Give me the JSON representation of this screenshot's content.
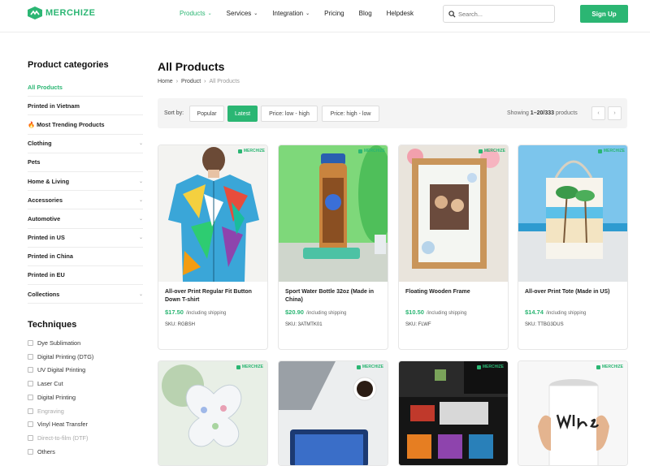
{
  "header": {
    "logo_text": "MERCHIZE",
    "nav": [
      {
        "label": "Products",
        "dropdown": true,
        "active": true
      },
      {
        "label": "Services",
        "dropdown": true,
        "active": false
      },
      {
        "label": "Integration",
        "dropdown": true,
        "active": false
      },
      {
        "label": "Pricing",
        "dropdown": false,
        "active": false
      },
      {
        "label": "Blog",
        "dropdown": false,
        "active": false
      },
      {
        "label": "Helpdesk",
        "dropdown": false,
        "active": false
      }
    ],
    "search_placeholder": "Search...",
    "signup_label": "Sign Up"
  },
  "sidebar": {
    "categories_title": "Product categories",
    "categories": [
      {
        "label": "All Products",
        "expandable": false
      },
      {
        "label": "Printed in Vietnam",
        "expandable": false
      },
      {
        "label": "Most Trending Products",
        "expandable": false,
        "icon": "fire-icon"
      },
      {
        "label": "Clothing",
        "expandable": true
      },
      {
        "label": "Pets",
        "expandable": false
      },
      {
        "label": "Home & Living",
        "expandable": true
      },
      {
        "label": "Accessories",
        "expandable": true
      },
      {
        "label": "Automotive",
        "expandable": true
      },
      {
        "label": "Printed in US",
        "expandable": true
      },
      {
        "label": "Printed in China",
        "expandable": false
      },
      {
        "label": "Printed in EU",
        "expandable": false
      },
      {
        "label": "Collections",
        "expandable": true
      }
    ],
    "techniques_title": "Techniques",
    "techniques": [
      {
        "label": "Dye Sublimation",
        "enabled": true
      },
      {
        "label": "Digital Printing (DTG)",
        "enabled": true
      },
      {
        "label": "UV Digital Printing",
        "enabled": true
      },
      {
        "label": "Laser Cut",
        "enabled": true
      },
      {
        "label": "Digital Printing",
        "enabled": true
      },
      {
        "label": "Engraving",
        "enabled": false
      },
      {
        "label": "Vinyl Heat Transfer",
        "enabled": true
      },
      {
        "label": "Direct-to-film (DTF)",
        "enabled": false
      },
      {
        "label": "Others",
        "enabled": true
      }
    ]
  },
  "main": {
    "title": "All Products",
    "breadcrumb": [
      "Home",
      "Product",
      "All Products"
    ],
    "sort_label": "Sort by:",
    "sort_options": [
      {
        "label": "Popular",
        "active": false
      },
      {
        "label": "Latest",
        "active": true
      },
      {
        "label": "Price: low - high",
        "active": false
      },
      {
        "label": "Price: high - low",
        "active": false
      }
    ],
    "showing_prefix": "Showing ",
    "showing_range": "1–20/333",
    "showing_suffix": " products",
    "prev_label": "‹",
    "next_label": "›"
  },
  "brand_mark": "MERCHIZE",
  "products": [
    {
      "name": "All-over Print Regular Fit Button Down T-shirt",
      "price": "$17.50",
      "shipping": "/including shipping",
      "sku": "SKU: RGBSH"
    },
    {
      "name": "Sport Water Bottle 32oz (Made in China)",
      "price": "$20.90",
      "shipping": "/including shipping",
      "sku": "SKU: 3ATMTK01"
    },
    {
      "name": "Floating Wooden Frame",
      "price": "$10.50",
      "shipping": "/including shipping",
      "sku": "SKU: FLWF"
    },
    {
      "name": "All-over Print Tote (Made in US)",
      "price": "$14.74",
      "shipping": "/including shipping",
      "sku": "SKU: TTBG3DUS"
    }
  ],
  "colors": {
    "accent": "#2bb673",
    "fire": "#f26522"
  }
}
